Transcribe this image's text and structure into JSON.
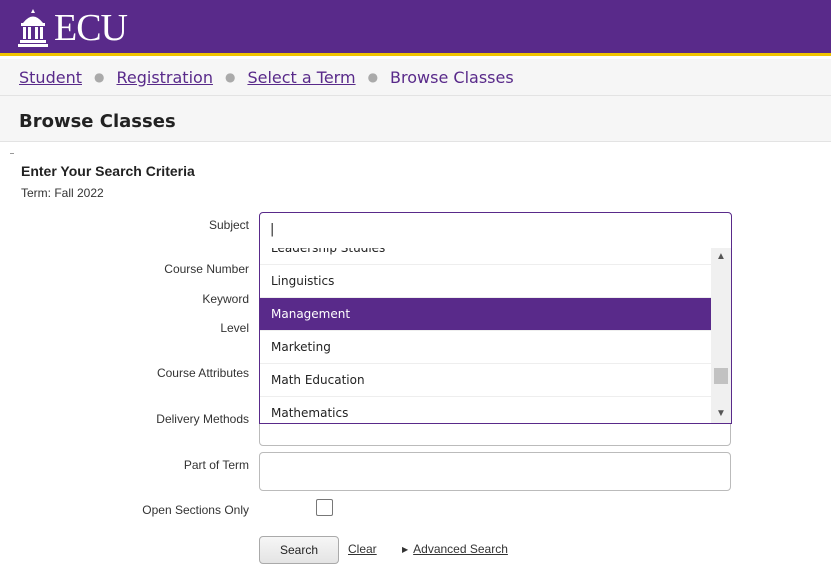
{
  "header": {
    "logo_text": "ECU",
    "colors": {
      "primary": "#592a8a",
      "accent": "#f0c300"
    }
  },
  "breadcrumb": {
    "items": [
      "Student",
      "Registration",
      "Select a Term"
    ],
    "current": "Browse Classes"
  },
  "page": {
    "title": "Browse Classes",
    "criteria_title": "Enter Your Search Criteria",
    "term": "Term: Fall 2022"
  },
  "form": {
    "subject": {
      "label": "Subject",
      "value": "|"
    },
    "subject_options": [
      "Leadership Studies",
      "Linguistics",
      "Management",
      "Marketing",
      "Math Education",
      "Mathematics"
    ],
    "selected_option": "Management",
    "course_number": {
      "label": "Course Number"
    },
    "keyword": {
      "label": "Keyword"
    },
    "level": {
      "label": "Level"
    },
    "course_attributes": {
      "label": "Course Attributes"
    },
    "delivery_methods": {
      "label": "Delivery Methods"
    },
    "part_of_term": {
      "label": "Part of Term"
    },
    "open_sections": {
      "label": "Open Sections Only"
    }
  },
  "actions": {
    "search": "Search",
    "clear": "Clear",
    "advanced": "Advanced Search"
  }
}
